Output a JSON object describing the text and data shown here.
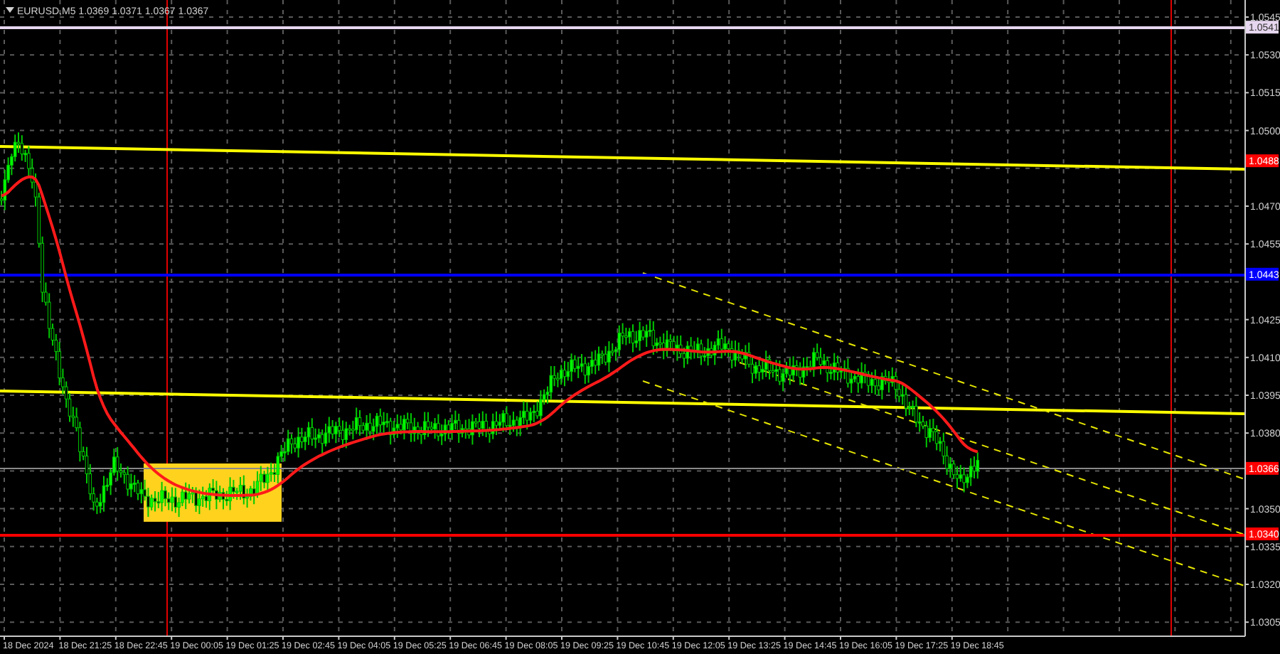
{
  "title": {
    "symbol": "EURUSD,M5",
    "values": [
      "1.0369",
      "1.0371",
      "1.0367",
      "1.0367"
    ]
  },
  "price_axis": {
    "labels": [
      "1.0545",
      "1.0530",
      "1.0515",
      "1.0500",
      "1.0470",
      "1.0455",
      "1.0425",
      "1.0410",
      "1.0395",
      "1.0380",
      "1.0350",
      "1.0335",
      "1.0320",
      "1.0305"
    ]
  },
  "levels": [
    {
      "kind": "line",
      "label": "1.0541",
      "color": "#e6d6ef"
    },
    {
      "kind": "tag",
      "label": "1.0488",
      "color": "#ff0000"
    },
    {
      "kind": "line",
      "label": "1.0443",
      "color": "#0000ff"
    },
    {
      "kind": "price",
      "label": "1.0366",
      "color": "#ff0000"
    },
    {
      "kind": "line",
      "label": "1.0340",
      "color": "#ff0000"
    }
  ],
  "time_axis": {
    "labels": [
      "18 Dec 2024",
      "18 Dec 21:25",
      "18 Dec 22:45",
      "19 Dec 00:05",
      "19 Dec 01:25",
      "19 Dec 02:45",
      "19 Dec 04:05",
      "19 Dec 05:25",
      "19 Dec 06:45",
      "19 Dec 08:05",
      "19 Dec 09:25",
      "19 Dec 10:45",
      "19 Dec 12:05",
      "19 Dec 13:25",
      "19 Dec 14:45",
      "19 Dec 16:05",
      "19 Dec 17:25",
      "19 Dec 18:45"
    ]
  }
}
